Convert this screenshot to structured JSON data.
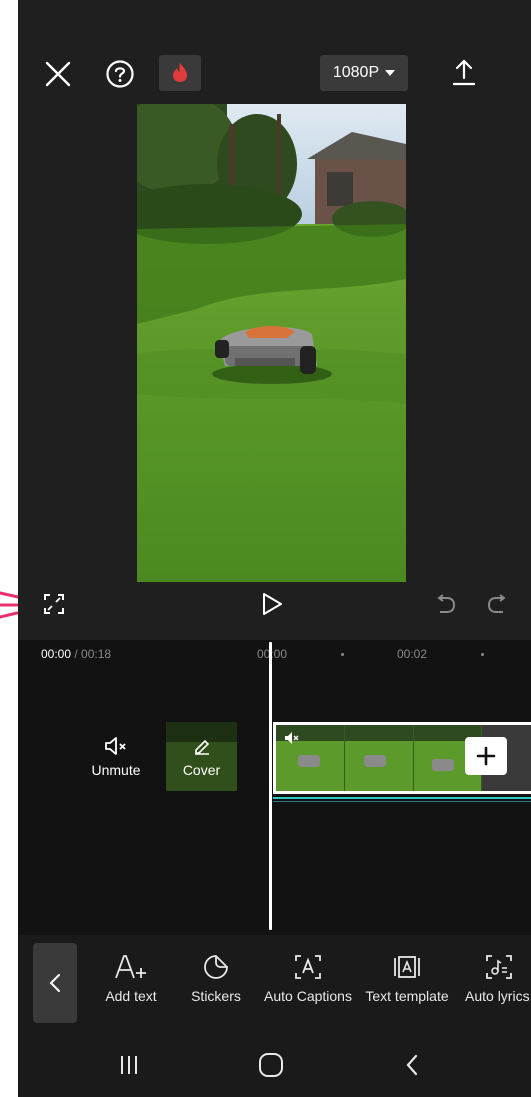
{
  "header": {
    "resolution_label": "1080P"
  },
  "timeline": {
    "current_time": "00:00",
    "total_time": " / 00:18",
    "ruler_ticks": [
      "00:00",
      "00:02"
    ]
  },
  "track": {
    "unmute_label": "Unmute",
    "cover_label": "Cover"
  },
  "toolbar": {
    "items": [
      {
        "label": "Add text",
        "icon": "add-text-icon"
      },
      {
        "label": "Stickers",
        "icon": "sticker-icon"
      },
      {
        "label": "Auto Captions",
        "icon": "auto-captions-icon"
      },
      {
        "label": "Text template",
        "icon": "text-template-icon"
      },
      {
        "label": "Auto lyrics",
        "icon": "auto-lyrics-icon"
      }
    ]
  },
  "colors": {
    "background": "#1f1f1f",
    "timeline_bg": "#121212",
    "accent_red": "#e23b3b",
    "audio_line": "#2fc6c6"
  }
}
